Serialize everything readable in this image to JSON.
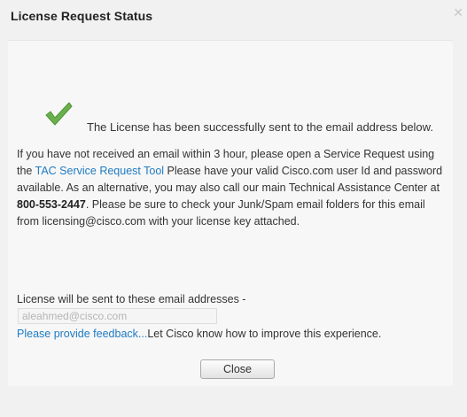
{
  "dialog": {
    "title": "License Request Status",
    "close_icon": "close-icon"
  },
  "success": {
    "icon": "checkmark-icon",
    "icon_color": "#6ab04c",
    "message": "The License has been successfully sent to the email address below."
  },
  "info": {
    "part1": "If you have not received an email within 3 hour, please open a Service Request using the ",
    "tac_link": "TAC Service Request Tool",
    "part2": " Please have your valid Cisco.com user Id and password available. As an alternative, you may also call our main Technical Assistance Center at ",
    "phone": "800-553-2447",
    "part3": ". Please be sure to check your Junk/Spam email folders for this email from licensing@cisco.com with your license key attached."
  },
  "email_section": {
    "label": "License will be sent to these email addresses -",
    "email_value": "aleahmed@cisco.com"
  },
  "feedback": {
    "link": "Please provide feedback...",
    "text": "Let Cisco know how to improve this experience."
  },
  "buttons": {
    "close_label": "Close"
  },
  "colors": {
    "link": "#1f7bc2",
    "background": "#f1f1f1",
    "content_bg": "#f7f7f7"
  }
}
